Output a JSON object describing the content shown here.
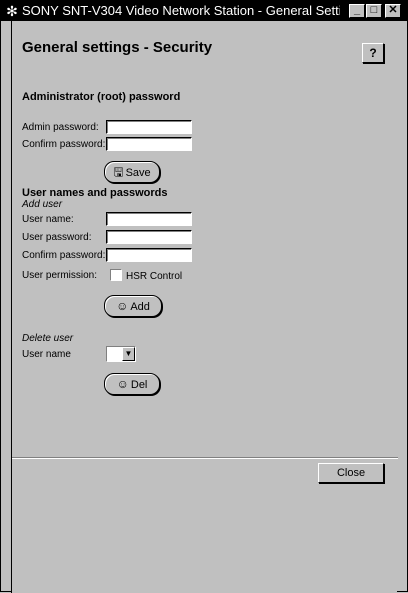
{
  "window": {
    "title": "SONY SNT-V304 Video Network Station - General Settin...",
    "app_icon": "network-icon",
    "minimize_glyph": "_",
    "maximize_glyph": "□",
    "close_glyph": "✕"
  },
  "page": {
    "heading": "General settings - Security",
    "help_label": "?"
  },
  "admin": {
    "section_title": "Administrator (root) password",
    "admin_password_label": "Admin password:",
    "admin_password_value": "",
    "confirm_password_label": "Confirm password:",
    "confirm_password_value": "",
    "save_label": "Save",
    "save_icon": "floppy-disk-icon"
  },
  "users": {
    "section_title": "User names and passwords",
    "add_user_label": "Add user",
    "user_name_label": "User name:",
    "user_name_value": "",
    "user_password_label": "User password:",
    "user_password_value": "",
    "confirm_password_label": "Confirm password:",
    "confirm_password_value": "",
    "permission_label": "User permission:",
    "hsr_control_label": "HSR Control",
    "hsr_control_checked": false,
    "add_label": "Add",
    "add_icon": "user-add-icon"
  },
  "delete": {
    "section_title": "Delete user",
    "user_name_label": "User name",
    "selected_user": "",
    "del_label": "Del",
    "del_icon": "user-delete-icon"
  },
  "footer": {
    "close_label": "Close"
  }
}
